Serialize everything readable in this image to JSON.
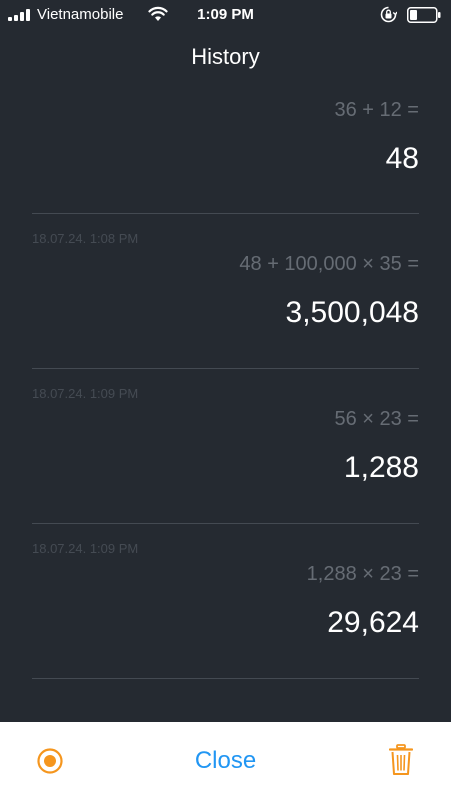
{
  "status_bar": {
    "carrier": "Vietnamobile",
    "time": "1:09 PM"
  },
  "header": {
    "title": "History"
  },
  "history": [
    {
      "timestamp": "",
      "expression": "36 + 12 =",
      "result": "48"
    },
    {
      "timestamp": "18.07.24. 1:08 PM",
      "expression": "48 + 100,000 × 35 =",
      "result": "3,500,048"
    },
    {
      "timestamp": "18.07.24. 1:09 PM",
      "expression": "56 × 23 =",
      "result": "1,288"
    },
    {
      "timestamp": "18.07.24. 1:09 PM",
      "expression": "1,288 × 23 =",
      "result": "29,624"
    }
  ],
  "bottom_bar": {
    "close_label": "Close",
    "record_icon": "record-icon",
    "trash_icon": "trash-icon"
  },
  "colors": {
    "background": "#252a31",
    "accent_orange": "#f5961e",
    "accent_blue": "#2196f3"
  }
}
